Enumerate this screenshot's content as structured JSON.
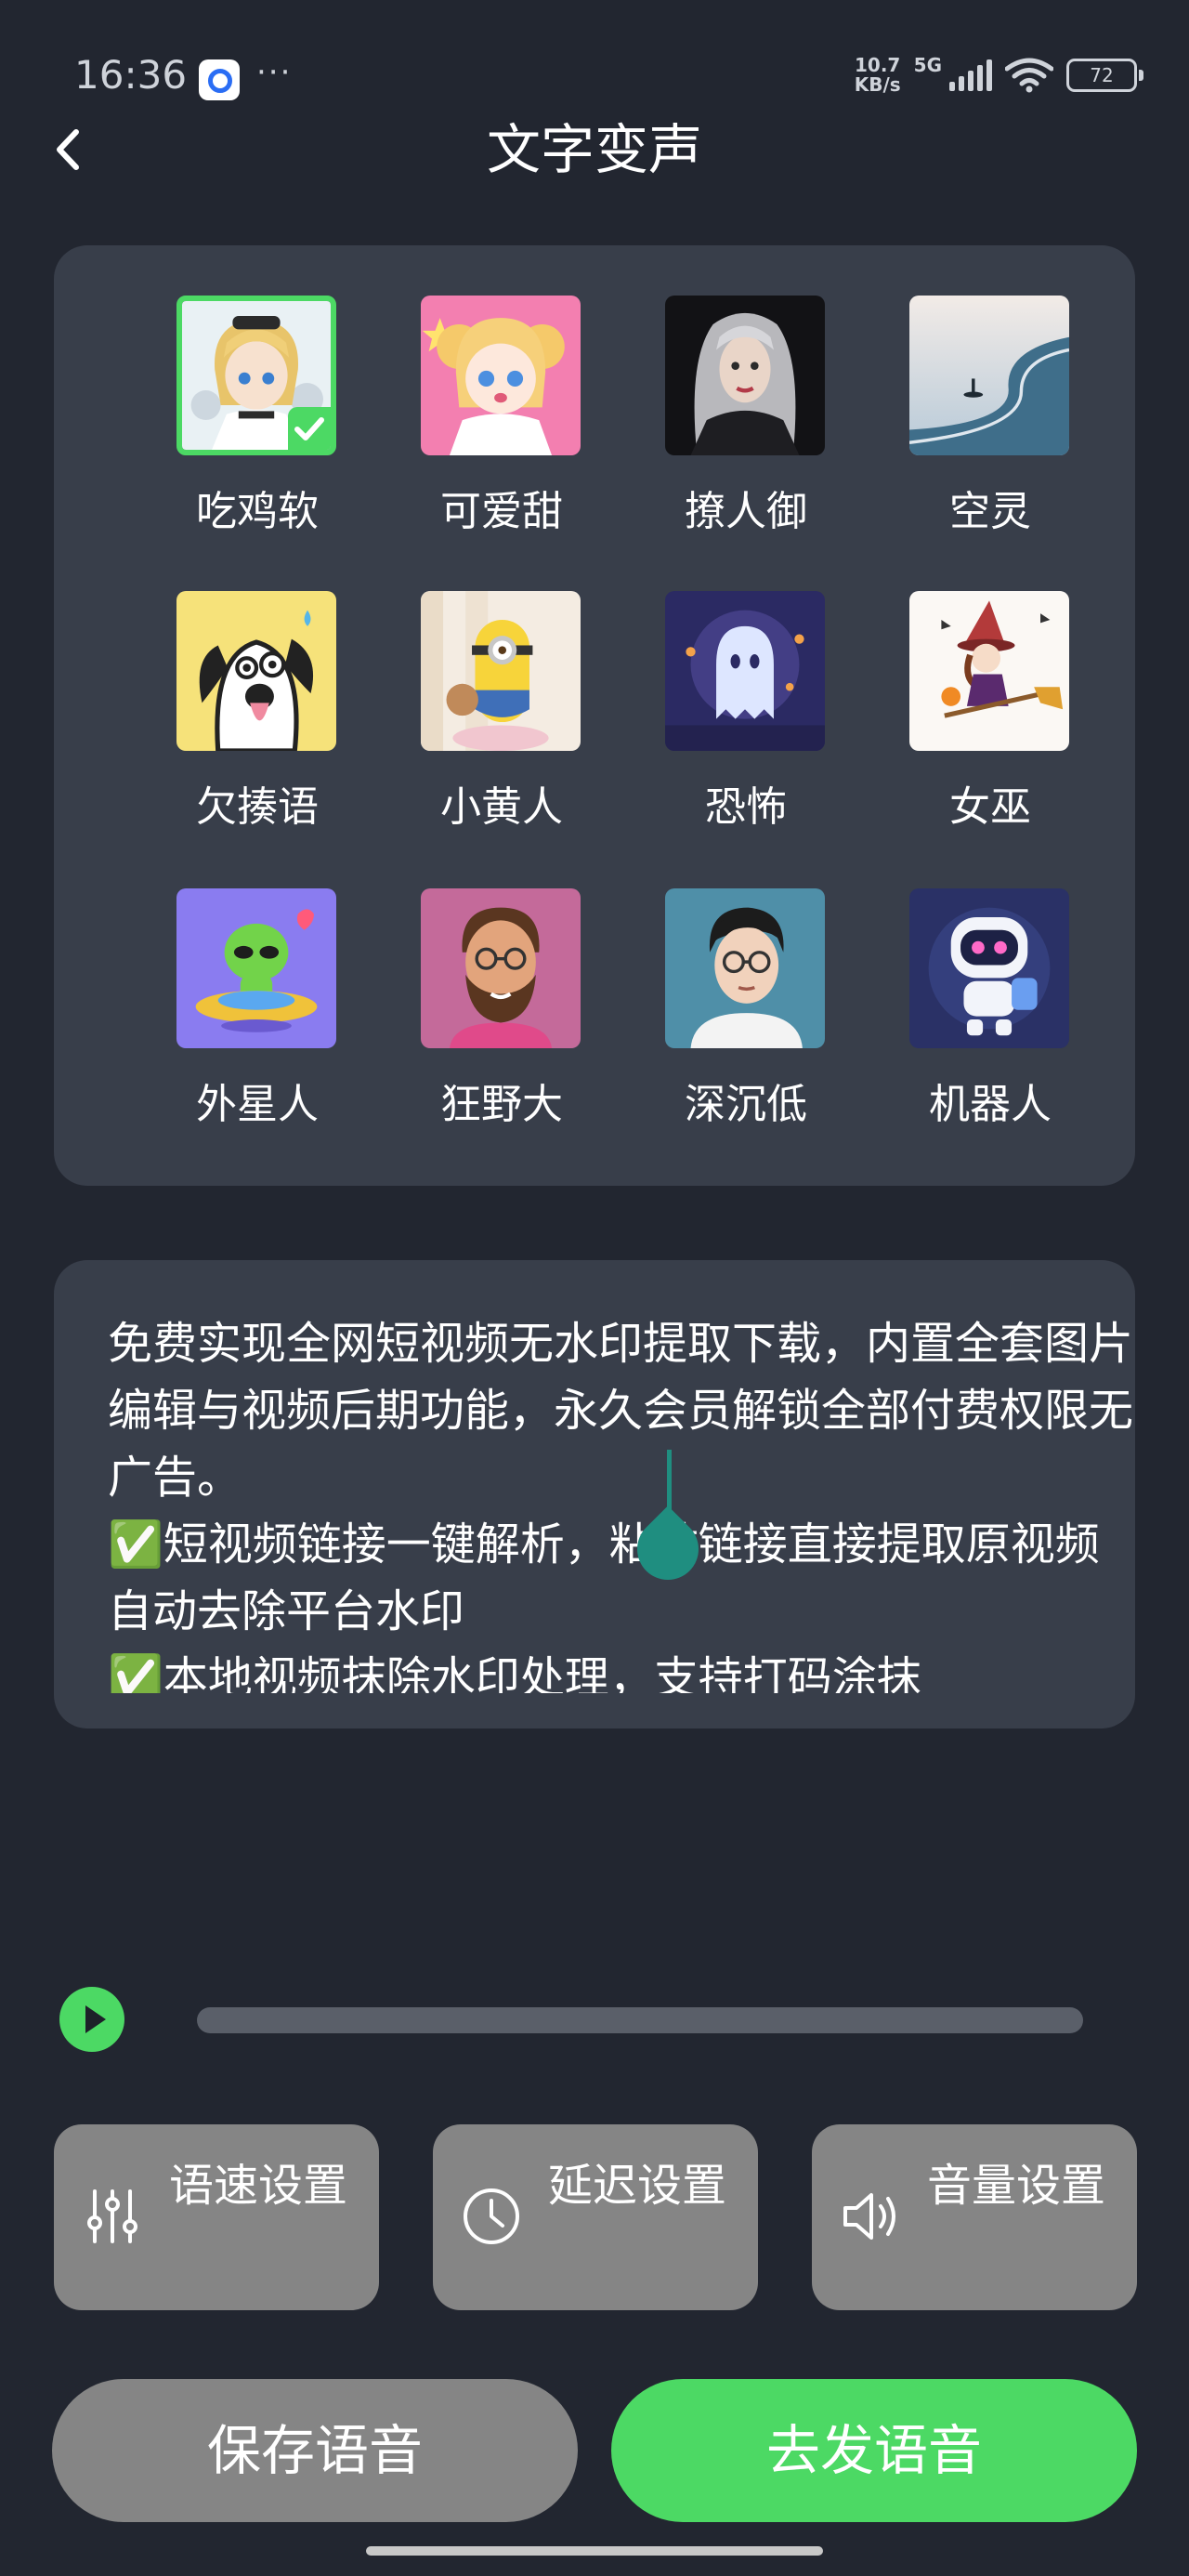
{
  "status_bar": {
    "time": "16:36",
    "more": "···",
    "net_speed_value": "10.7",
    "net_speed_unit": "KB/s",
    "network": "5G",
    "battery": "72"
  },
  "header": {
    "title": "文字变声"
  },
  "voices": [
    {
      "label": "吃鸡软",
      "selected": true
    },
    {
      "label": "可爱甜",
      "selected": false
    },
    {
      "label": "撩人御",
      "selected": false
    },
    {
      "label": "空灵",
      "selected": false
    },
    {
      "label": "欠揍语",
      "selected": false
    },
    {
      "label": "小黄人",
      "selected": false
    },
    {
      "label": "恐怖",
      "selected": false
    },
    {
      "label": "女巫",
      "selected": false
    },
    {
      "label": "外星人",
      "selected": false
    },
    {
      "label": "狂野大",
      "selected": false
    },
    {
      "label": "深沉低",
      "selected": false
    },
    {
      "label": "机器人",
      "selected": false
    }
  ],
  "text_input": {
    "value": "免费实现全网短视频无水印提取下载，内置全套图片编辑与视频后期功能，永久会员解锁全部付费权限无广告。\n✅短视频链接一键解析，粘贴链接直接提取原视频自动去除平台水印\n✅本地视频抹除水印处理，支持打码涂抹"
  },
  "player": {
    "progress": 0
  },
  "settings": {
    "speed_label": "语速设置",
    "delay_label": "延迟设置",
    "volume_label": "音量设置"
  },
  "actions": {
    "save_label": "保存语音",
    "send_label": "去发语音"
  },
  "colors": {
    "accent": "#4cd964",
    "background": "#222630",
    "card": "#383e4a",
    "button_gray": "#858585",
    "cursor": "#1f8e80"
  }
}
